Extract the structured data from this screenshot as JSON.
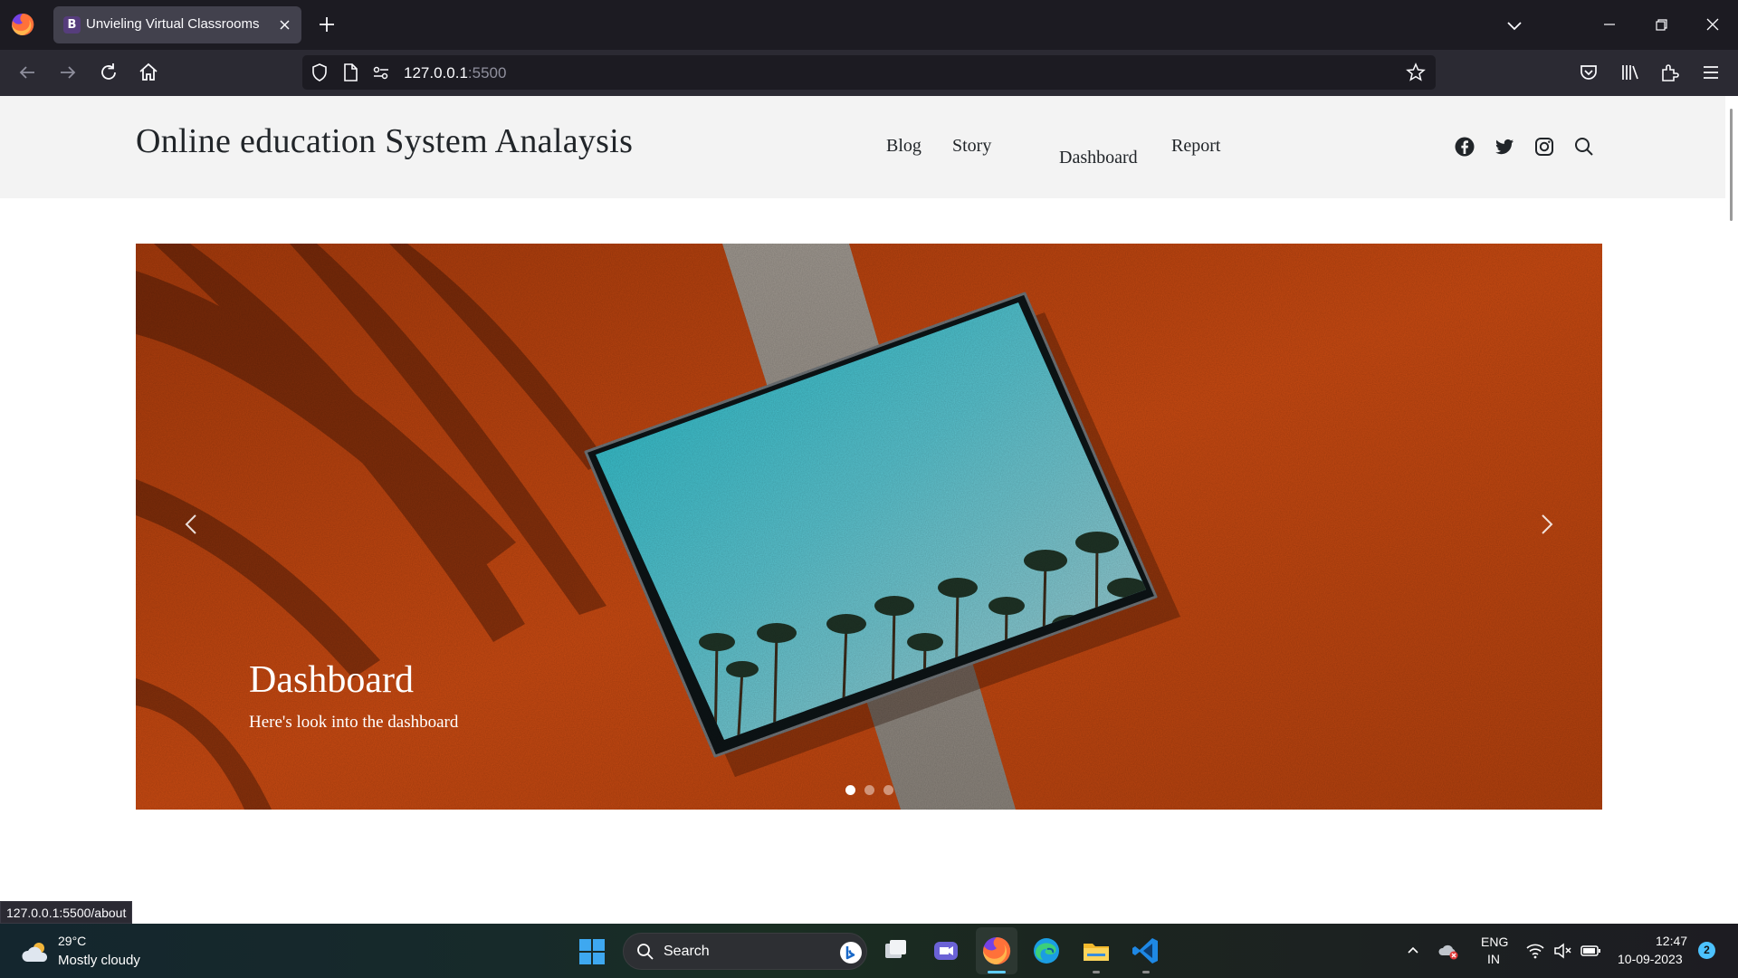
{
  "browser": {
    "tab_title": "Unvieling Virtual Classrooms",
    "tab_favicon_letter": "B",
    "url_host": "127.0.0.1",
    "url_port": ":5500"
  },
  "site": {
    "title": "Online education System Analaysis",
    "nav": [
      "Blog",
      "Story",
      "Dashboard",
      "Report"
    ],
    "social_icons": [
      "facebook-icon",
      "twitter-icon",
      "instagram-icon",
      "search-icon"
    ]
  },
  "carousel": {
    "caption_title": "Dashboard",
    "caption_text": "Here's look into the dashboard",
    "slide_count": 3,
    "active_slide": 1
  },
  "status_bar": {
    "link": "127.0.0.1:5500/about"
  },
  "taskbar": {
    "weather_temp": "29°C",
    "weather_desc": "Mostly cloudy",
    "search_label": "Search",
    "language": "ENG",
    "region": "IN",
    "time": "12:47",
    "date": "10-09-2023",
    "notification_count": "2"
  },
  "colors": {
    "tabbar": "#1c1b22",
    "toolbar": "#2b2a33",
    "header_bg": "#f3f3f3",
    "carousel_orange": "#c4470f"
  }
}
